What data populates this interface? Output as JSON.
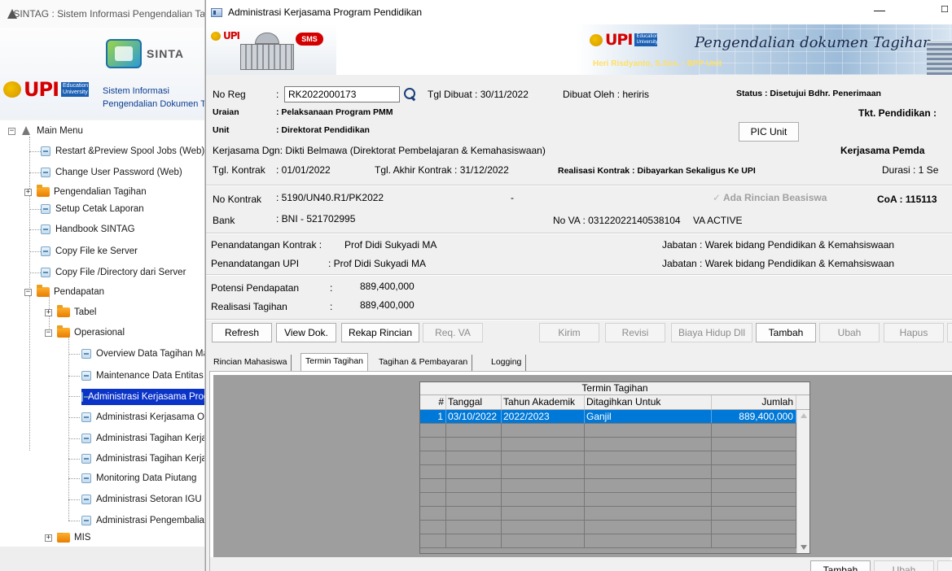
{
  "bg_window": {
    "title": "SINTAG : Sistem Informasi Pengendalian Ta",
    "logo_upi": "UPI",
    "logo_upi_sub": "Education University",
    "logo_sintag": "SINTA",
    "banner_line1": "Sistem Informasi",
    "banner_line2": "Pengendalian Dokumen Ta",
    "tree": {
      "main_menu": "Main Menu",
      "restart": "Restart &Preview Spool Jobs (Web)",
      "change_pw": "Change User Password (Web)",
      "pengendalian": "Pengendalian Tagihan",
      "setup": "Setup Cetak Laporan",
      "handbook": "Handbook SINTAG",
      "copy_file": "Copy File ke Server",
      "copy_dir": "Copy File /Directory dari Server",
      "pendapatan": "Pendapatan",
      "tabel": "Tabel",
      "operasional": "Operasional",
      "op_items": [
        "Overview Data Tagihan Maha",
        "Maintenance Data Entitas Ke",
        "Administrasi Kerjasama Prog",
        "Administrasi Kerjasama Ope",
        "Administrasi Tagihan Kerjasa",
        "Administrasi Tagihan Kerjasa",
        "Monitoring Data Piutang",
        "Administrasi Setoran IGU - P",
        "Administrasi Pengembalian F"
      ],
      "mis": "MIS"
    }
  },
  "window": {
    "title": "Administrasi Kerjasama Program Pendidikan",
    "min": "—",
    "max": "☐"
  },
  "banner": {
    "upi": "UPI",
    "upi_sub": "Education University",
    "sms": "SMS",
    "title": "Pengendalian dokumen Tagihan",
    "author": "Heri Risdyanto, S.Sos. - BPP Unit"
  },
  "info": {
    "no_reg_label": "No Reg",
    "no_reg_value": "RK2022000173",
    "tgl_dibuat": "Tgl Dibuat :  30/11/2022",
    "dibuat_oleh": "Dibuat Oleh  :  heriris",
    "status": "Status  :  Disetujui Bdhr. Penerimaan",
    "uraian_label": "Uraian",
    "uraian_value": ":  Pelaksanaan Program PMM",
    "tkt_pendidikan": "Tkt. Pendidikan :",
    "unit_label": "Unit",
    "unit_value": ":  Direktorat Pendidikan",
    "pic_unit": "PIC Unit",
    "kerjasama_dgn": "Kerjasama Dgn:  Dikti Belmawa (Direktorat Pembelajaran & Kemahasiswaan)",
    "kerjasama_pemda": "Kerjasama Pemda",
    "tgl_kontrak_label": "Tgl. Kontrak",
    "tgl_kontrak_value": ":  01/01/2022",
    "tgl_akhir": "Tgl. Akhir Kontrak  : 31/12/2022",
    "realisasi_kontrak": "Realisasi Kontrak  :  Dibayarkan Sekaligus Ke UPI",
    "durasi": "Durasi  :  1 Se",
    "no_kontrak_label": "No Kontrak",
    "no_kontrak_value": ":  5190/UN40.R1/PK2022",
    "dash": "-",
    "ada_rincian": "Ada Rincian Beasiswa",
    "coa": "CoA   :  115113",
    "bank_label": "Bank",
    "bank_value": ":  BNI - 521702995",
    "no_va": "No VA :  03122022140538104",
    "va_active": "VA ACTIVE",
    "pttd_kontrak_label": "Penandatangan Kontrak :",
    "pttd_kontrak_value": "Prof Didi Sukyadi MA",
    "jabatan1": "Jabatan  :  Warek bidang Pendidikan & Kemahsiswaan",
    "pttd_upi_label": "Penandatangan UPI",
    "pttd_upi_value": ":  Prof Didi Sukyadi MA",
    "jabatan2": "Jabatan  :  Warek bidang Pendidikan & Kemahsiswaan",
    "potensi_label": "Potensi Pendapatan",
    "potensi_colon": ":",
    "potensi_value": "889,400,000",
    "realisasi_label": "Realisasi Tagihan",
    "realisasi_colon": ":",
    "realisasi_value": "889,400,000"
  },
  "toolbar": {
    "refresh": "Refresh",
    "view_dok": "View Dok.",
    "rekap": "Rekap Rincian",
    "req_va": "Req. VA",
    "kirim": "Kirim",
    "revisi": "Revisi",
    "biaya": "Biaya Hidup Dll",
    "tambah": "Tambah",
    "ubah": "Ubah",
    "hapus": "Hapus"
  },
  "tabs": [
    "Rincian Mahasiswa",
    "Termin Tagihan",
    "Tagihan & Pembayaran",
    "Logging"
  ],
  "grid": {
    "caption": "Termin Tagihan",
    "columns": [
      "#",
      "Tanggal",
      "Tahun Akademik",
      "Ditagihkan Untuk",
      "Jumlah"
    ],
    "rows": [
      [
        "1",
        "03/10/2022",
        "2022/2023",
        "Ganjil",
        "889,400,000"
      ]
    ]
  },
  "bottom": {
    "tambah": "Tambah",
    "ubah": "Ubah"
  }
}
